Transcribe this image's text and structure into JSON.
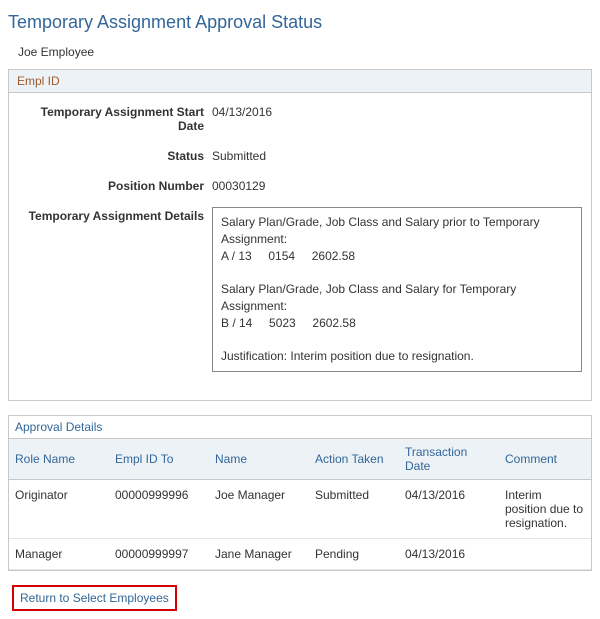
{
  "page": {
    "title": "Temporary Assignment Approval Status",
    "employee_name": "Joe Employee"
  },
  "empl_id_section": {
    "header": "Empl ID",
    "fields": {
      "start_date": {
        "label": "Temporary Assignment Start Date",
        "value": "04/13/2016"
      },
      "status": {
        "label": "Status",
        "value": "Submitted"
      },
      "position_number": {
        "label": "Position Number",
        "value": "00030129"
      },
      "details": {
        "label": "Temporary Assignment Details",
        "value": "Salary Plan/Grade, Job Class and Salary prior to Temporary Assignment:\nA / 13     0154     2602.58\n\nSalary Plan/Grade, Job Class and Salary for Temporary Assignment:\nB / 14     5023     2602.58\n\nJustification: Interim position due to resignation."
      }
    }
  },
  "approval_details": {
    "header": "Approval Details",
    "columns": {
      "role_name": "Role Name",
      "empl_id_to": "Empl ID To",
      "name": "Name",
      "action_taken": "Action Taken",
      "transaction_date": "Transaction Date",
      "comment": "Comment"
    },
    "rows": [
      {
        "role_name": "Originator",
        "empl_id_to": "00000999996",
        "name": "Joe Manager",
        "action_taken": "Submitted",
        "transaction_date": "04/13/2016",
        "comment": "Interim position due to resignation."
      },
      {
        "role_name": "Manager",
        "empl_id_to": "00000999997",
        "name": "Jane Manager",
        "action_taken": "Pending",
        "transaction_date": "04/13/2016",
        "comment": ""
      }
    ]
  },
  "actions": {
    "return_link": "Return to Select Employees"
  }
}
